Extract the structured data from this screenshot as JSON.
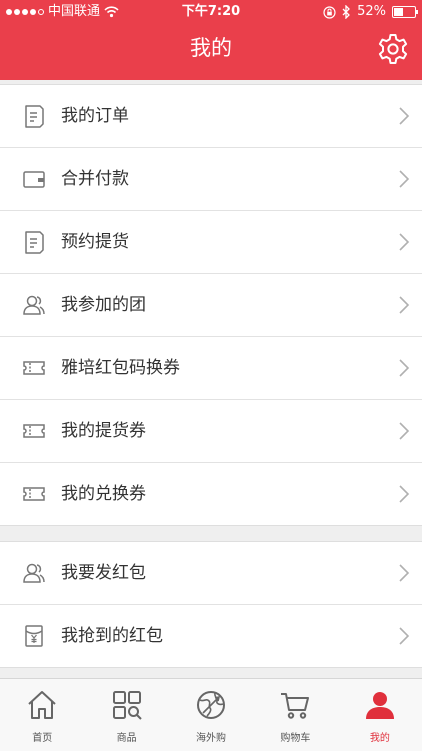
{
  "status_bar": {
    "carrier": "中国联通",
    "time": "下午7:20",
    "battery": "52%",
    "battery_level": 0.52
  },
  "header": {
    "title": "我的",
    "settings_icon": "gear-icon"
  },
  "groups": [
    {
      "items": [
        {
          "label": "我的订单",
          "icon": "document-icon"
        },
        {
          "label": "合并付款",
          "icon": "wallet-icon"
        },
        {
          "label": "预约提货",
          "icon": "document-icon"
        },
        {
          "label": "我参加的团",
          "icon": "group-icon"
        },
        {
          "label": "雅培红包码换券",
          "icon": "ticket-icon"
        },
        {
          "label": "我的提货券",
          "icon": "ticket-icon"
        },
        {
          "label": "我的兑换券",
          "icon": "ticket-icon"
        }
      ]
    },
    {
      "items": [
        {
          "label": "我要发红包",
          "icon": "group-icon"
        },
        {
          "label": "我抢到的红包",
          "icon": "red-envelope-icon"
        }
      ]
    }
  ],
  "tabbar": {
    "items": [
      {
        "label": "首页",
        "icon": "home-icon"
      },
      {
        "label": "商品",
        "icon": "grid-search-icon"
      },
      {
        "label": "海外购",
        "icon": "globe-plane-icon"
      },
      {
        "label": "购物车",
        "icon": "cart-icon"
      },
      {
        "label": "我的",
        "icon": "user-icon",
        "active": true
      }
    ]
  },
  "colors": {
    "accent": "#ea3f4b",
    "active_tab": "#e0303c",
    "icon_gray": "#777777"
  }
}
